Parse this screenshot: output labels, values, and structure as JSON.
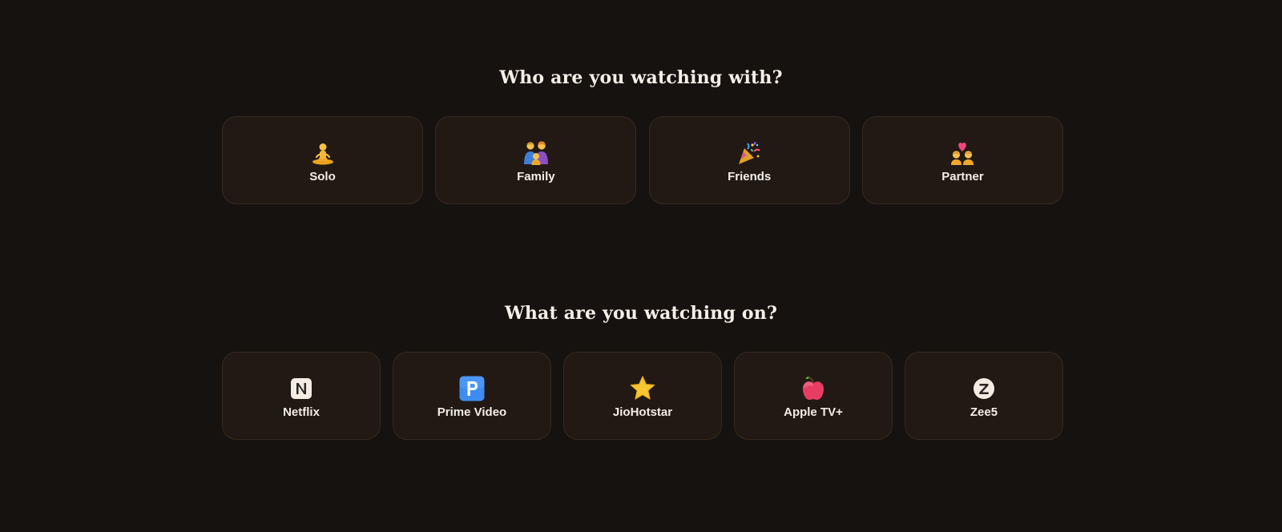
{
  "companion_section": {
    "title": "Who are you watching with?",
    "options": [
      {
        "label": "Solo",
        "icon": "person-meditating-icon"
      },
      {
        "label": "Family",
        "icon": "family-icon"
      },
      {
        "label": "Friends",
        "icon": "party-popper-icon"
      },
      {
        "label": "Partner",
        "icon": "couple-with-heart-icon"
      }
    ]
  },
  "platform_section": {
    "title": "What are you watching on?",
    "options": [
      {
        "label": "Netflix",
        "icon": "letter-n-icon"
      },
      {
        "label": "Prime Video",
        "icon": "letter-p-icon"
      },
      {
        "label": "JioHotstar",
        "icon": "star-icon"
      },
      {
        "label": "Apple TV+",
        "icon": "apple-icon"
      },
      {
        "label": "Zee5",
        "icon": "letter-z-icon"
      }
    ]
  },
  "colors": {
    "background": "#161210",
    "card_background": "#221914",
    "card_border": "#34291f",
    "text": "#f3ede6"
  }
}
